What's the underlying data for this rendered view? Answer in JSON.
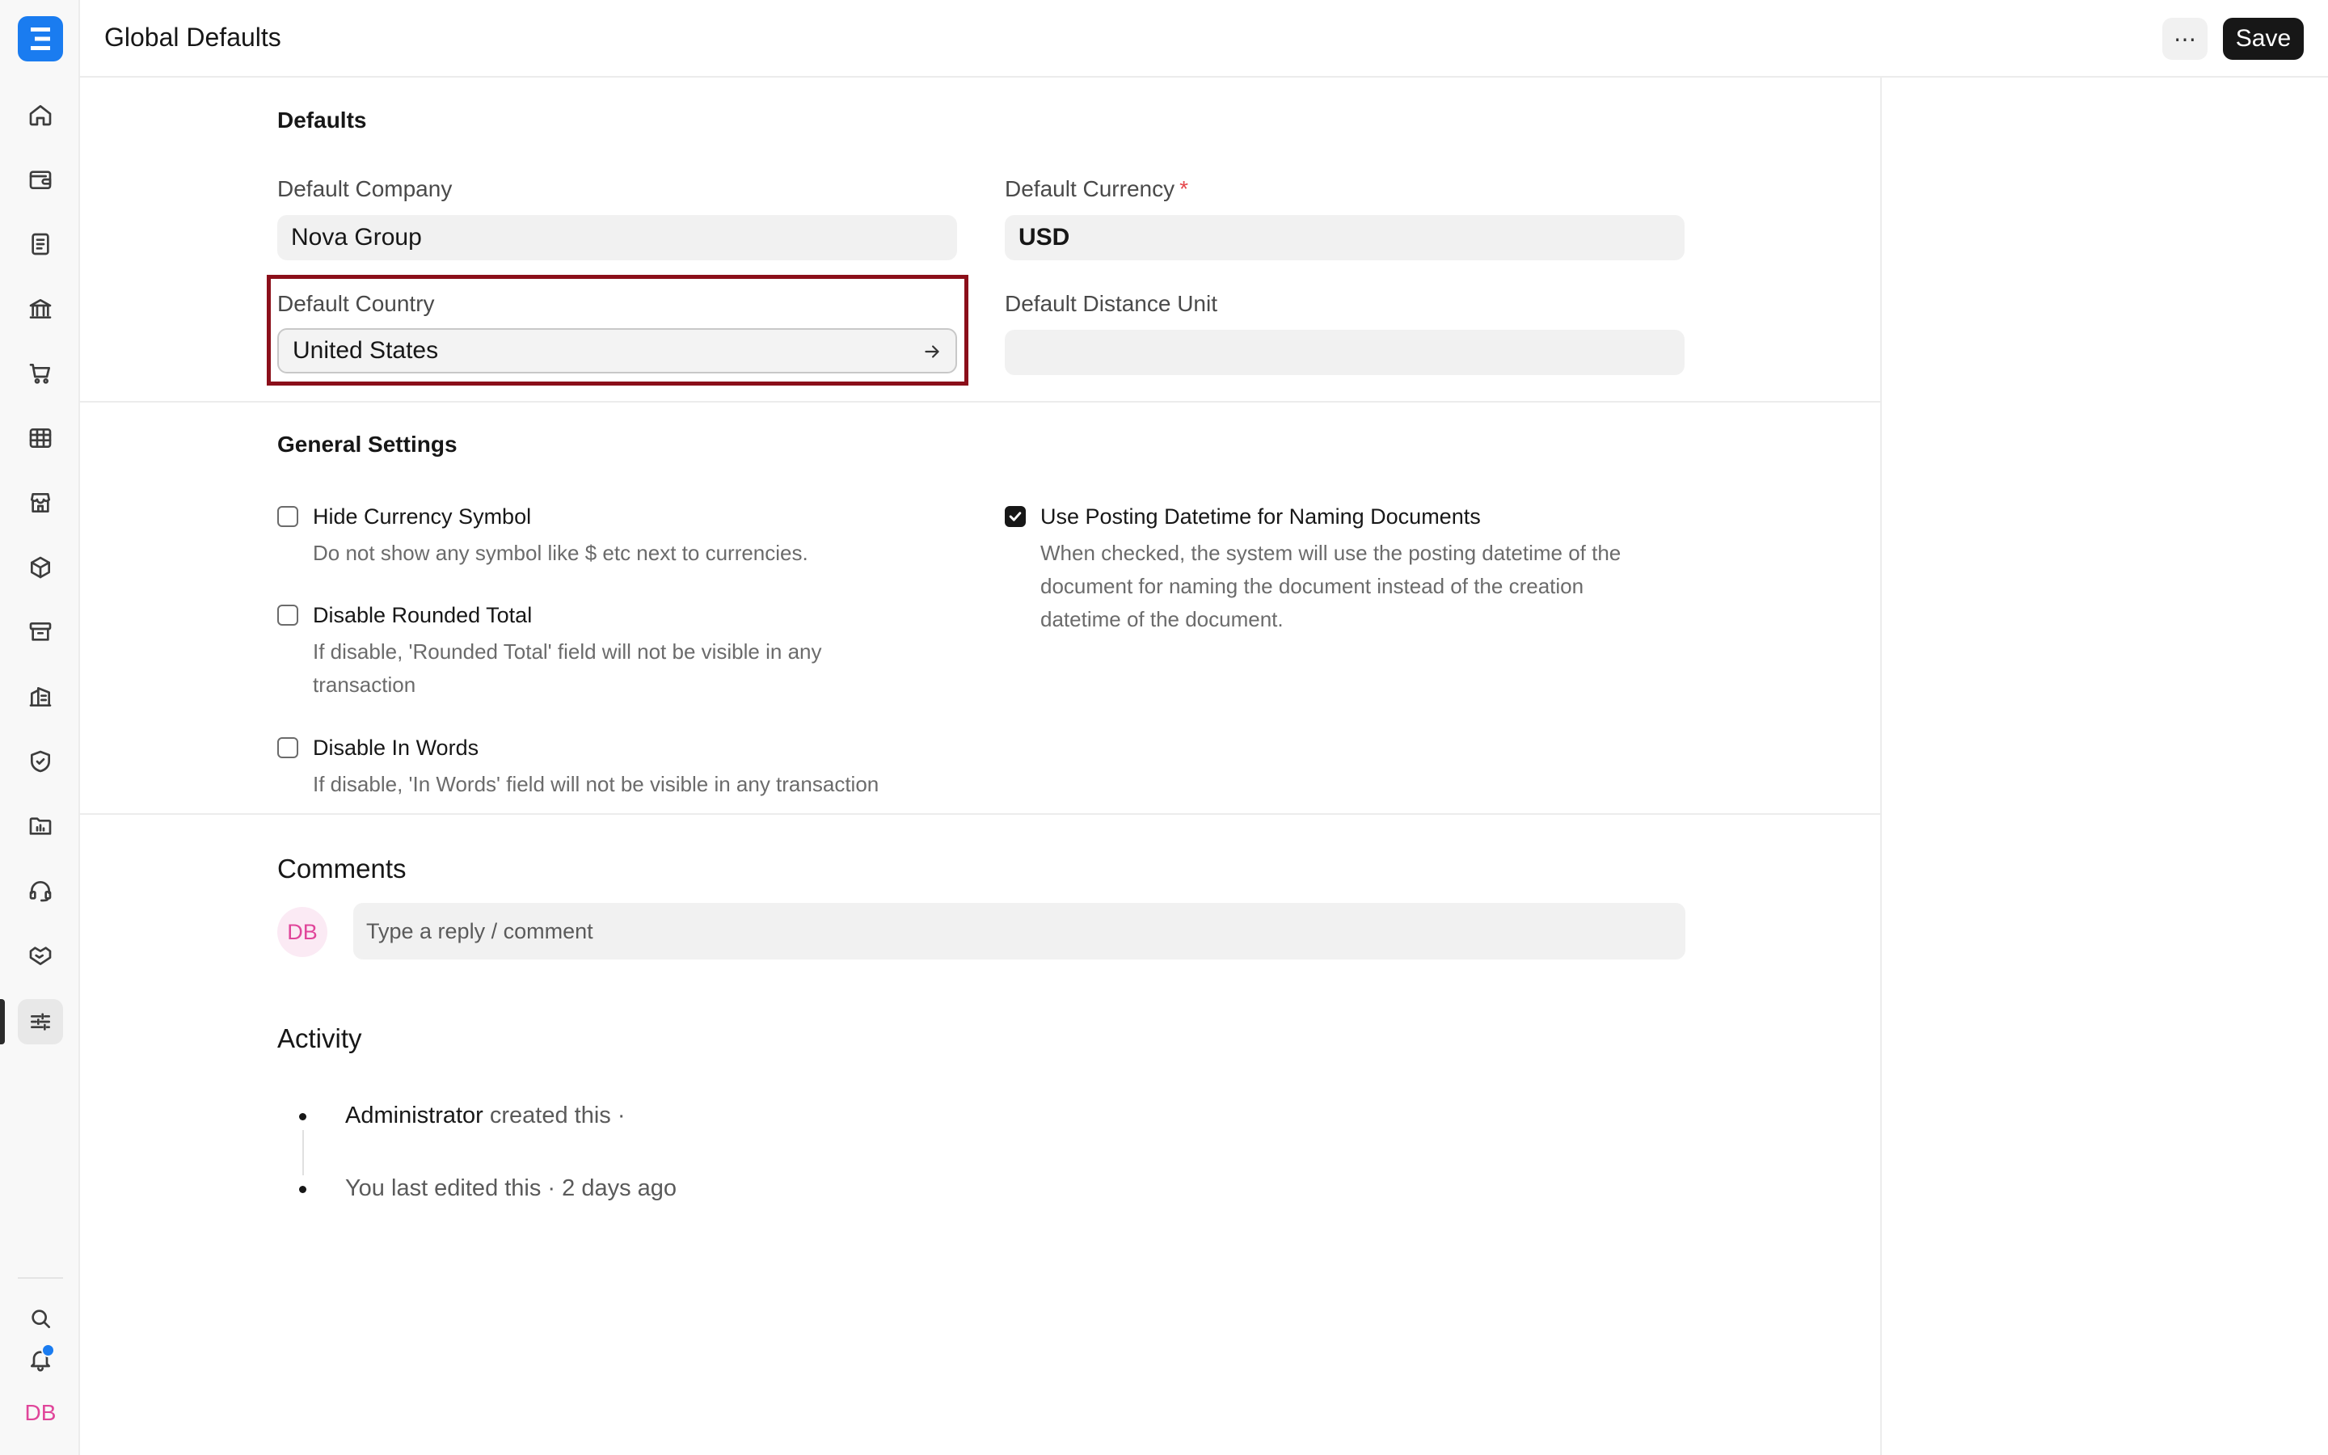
{
  "header": {
    "title": "Global Defaults",
    "more_label": "⋯",
    "save_label": "Save"
  },
  "sidebar": {
    "items": [
      {
        "name": "home-icon"
      },
      {
        "name": "wallet-icon"
      },
      {
        "name": "document-icon"
      },
      {
        "name": "bank-icon"
      },
      {
        "name": "cart-icon"
      },
      {
        "name": "table-icon"
      },
      {
        "name": "store-icon"
      },
      {
        "name": "package-icon"
      },
      {
        "name": "archive-icon"
      },
      {
        "name": "building-icon"
      },
      {
        "name": "shield-icon"
      },
      {
        "name": "chart-folder-icon"
      },
      {
        "name": "headset-icon"
      },
      {
        "name": "handshake-icon"
      },
      {
        "name": "sliders-icon",
        "active": true
      }
    ],
    "search_icon": "search-icon",
    "notification_icon": "bell-icon",
    "user_initials": "DB"
  },
  "defaults": {
    "section_title": "Defaults",
    "company": {
      "label": "Default Company",
      "value": "Nova Group"
    },
    "currency": {
      "label": "Default Currency",
      "required_mark": "*",
      "value": "USD"
    },
    "country": {
      "label": "Default Country",
      "value": "United States"
    },
    "distance_unit": {
      "label": "Default Distance Unit",
      "value": ""
    }
  },
  "general": {
    "section_title": "General Settings",
    "hide_currency_symbol": {
      "label": "Hide Currency Symbol",
      "checked": false,
      "description": "Do not show any symbol like $ etc next to currencies."
    },
    "disable_rounded_total": {
      "label": "Disable Rounded Total",
      "checked": false,
      "description_line1": "If disable, 'Rounded Total' field will not be visible in any",
      "description_line2": "transaction"
    },
    "disable_in_words": {
      "label": "Disable In Words",
      "checked": false,
      "description": "If disable, 'In Words' field will not be visible in any transaction"
    },
    "use_posting_datetime": {
      "label": "Use Posting Datetime for Naming Documents",
      "checked": true,
      "description_line1": "When checked, the system will use the posting datetime of the",
      "description_line2": "document for naming the document instead of the creation",
      "description_line3": "datetime of the document."
    }
  },
  "comments": {
    "title": "Comments",
    "avatar_initials": "DB",
    "placeholder": "Type a reply / comment"
  },
  "activity": {
    "title": "Activity",
    "items": [
      {
        "who": "Administrator",
        "text": " created this ·"
      },
      {
        "who": "",
        "text": "You last edited this · 2 days ago"
      }
    ]
  },
  "colors": {
    "accent": "#1a7cf0",
    "highlight_border": "#8b0f1a",
    "avatar_pink": "#e0459a",
    "required": "#e5484d"
  }
}
